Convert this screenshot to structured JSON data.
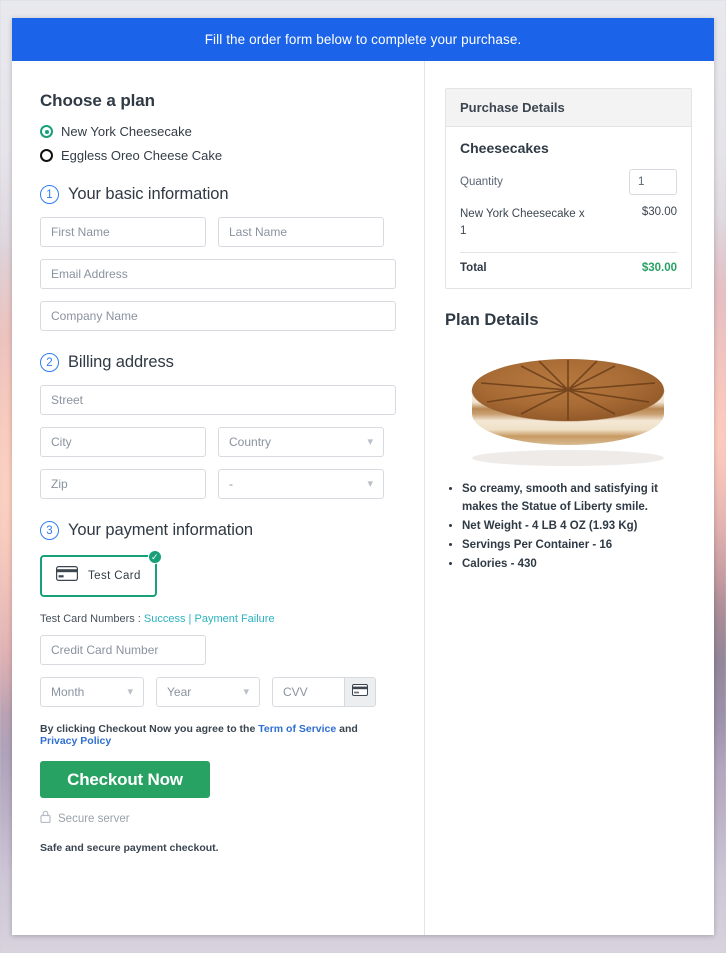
{
  "banner": {
    "text": "Fill the order form below to complete your purchase."
  },
  "plan": {
    "title": "Choose a plan",
    "options": [
      {
        "label": "New York Cheesecake",
        "selected": true
      },
      {
        "label": "Eggless Oreo Cheese Cake",
        "selected": false
      }
    ]
  },
  "step1": {
    "number": "1",
    "title": "Your basic information",
    "first_name_placeholder": "First Name",
    "last_name_placeholder": "Last Name",
    "email_placeholder": "Email Address",
    "company_placeholder": "Company Name"
  },
  "step2": {
    "number": "2",
    "title": "Billing address",
    "street_placeholder": "Street",
    "city_placeholder": "City",
    "country_value": "Country",
    "zip_placeholder": "Zip",
    "state_value": "-"
  },
  "step3": {
    "number": "3",
    "title": "Your payment information",
    "test_card_label": "Test Card",
    "test_numbers_prefix": "Test Card Numbers : ",
    "link_success": "Success",
    "link_separator": " | ",
    "link_failure": "Payment Failure",
    "card_number_placeholder": "Credit Card Number",
    "month_value": "Month",
    "year_value": "Year",
    "cvv_placeholder": "CVV"
  },
  "footer": {
    "agree_prefix": "By clicking Checkout Now you agree to the ",
    "terms_link": "Term of Service",
    "agree_middle": " and ",
    "privacy_link": "Privacy Policy",
    "checkout_button": "Checkout Now",
    "secure_server": "Secure server",
    "safe_note": "Safe and secure payment checkout."
  },
  "purchase_details": {
    "header": "Purchase Details",
    "subtitle": "Cheesecakes",
    "quantity_label": "Quantity",
    "quantity_value": "1",
    "line_item_name": "New York Cheesecake x 1",
    "line_item_amount": "$30.00",
    "total_label": "Total",
    "total_amount": "$30.00"
  },
  "plan_details": {
    "title": "Plan Details",
    "image_alt": "cheesecake-photo",
    "bullets": [
      "So creamy, smooth and satisfying it makes the Statue of Liberty smile.",
      "Net Weight - 4 LB 4 OZ (1.93 Kg)",
      "Servings Per Container - 16",
      "Calories - 430"
    ]
  },
  "colors": {
    "banner_blue": "#1b63e8",
    "accent_green": "#28a263",
    "radio_green": "#17a07a",
    "step_blue": "#2f7df4",
    "link_teal": "#2bb3c0"
  }
}
